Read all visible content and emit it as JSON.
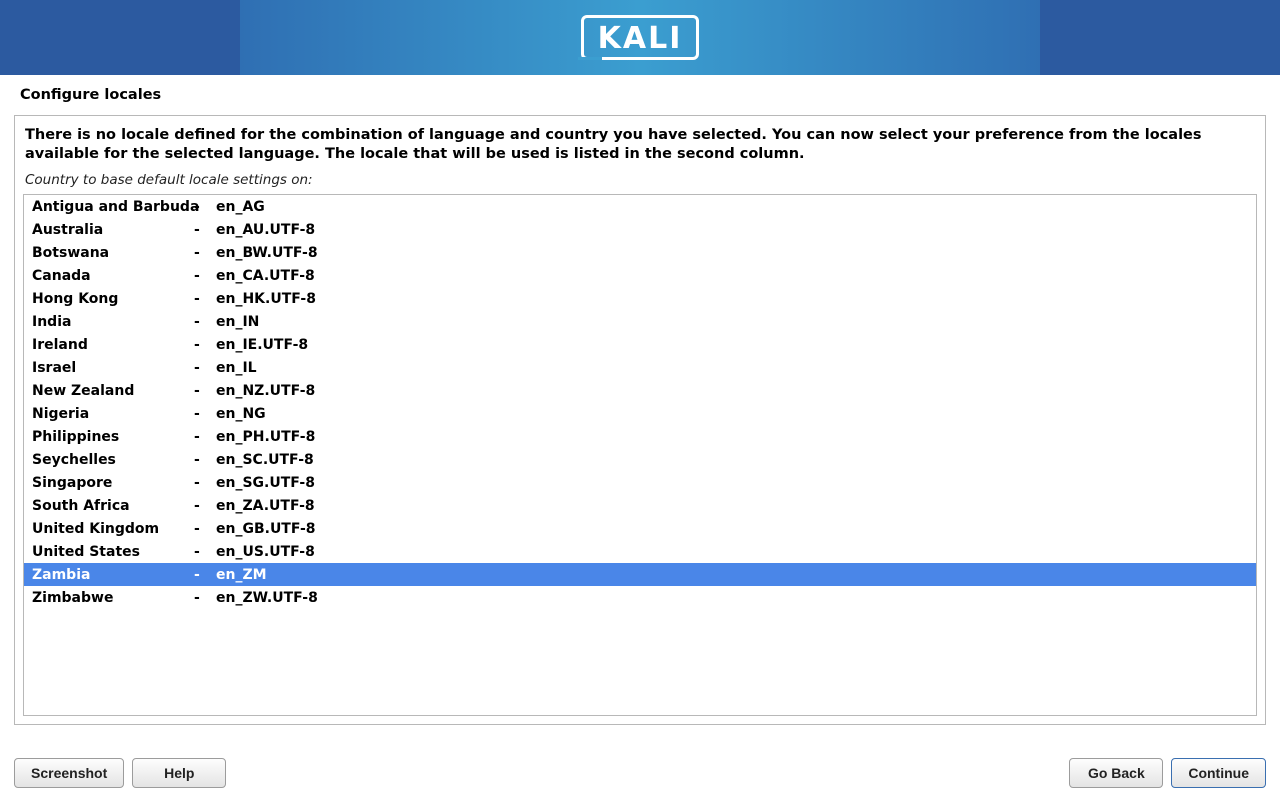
{
  "header": {
    "logo_text": "KALI"
  },
  "page_title": "Configure locales",
  "description": "There is no locale defined for the combination of language and country you have selected. You can now select your preference from the locales available for the selected language. The locale that will be used is listed in the second column.",
  "sub_caption": "Country to base default locale settings on:",
  "selected_index": 16,
  "locales": [
    {
      "country": "Antigua and Barbuda",
      "locale": "en_AG"
    },
    {
      "country": "Australia",
      "locale": "en_AU.UTF-8"
    },
    {
      "country": "Botswana",
      "locale": "en_BW.UTF-8"
    },
    {
      "country": "Canada",
      "locale": "en_CA.UTF-8"
    },
    {
      "country": "Hong Kong",
      "locale": "en_HK.UTF-8"
    },
    {
      "country": "India",
      "locale": "en_IN"
    },
    {
      "country": "Ireland",
      "locale": "en_IE.UTF-8"
    },
    {
      "country": "Israel",
      "locale": "en_IL"
    },
    {
      "country": "New Zealand",
      "locale": "en_NZ.UTF-8"
    },
    {
      "country": "Nigeria",
      "locale": "en_NG"
    },
    {
      "country": "Philippines",
      "locale": "en_PH.UTF-8"
    },
    {
      "country": "Seychelles",
      "locale": "en_SC.UTF-8"
    },
    {
      "country": "Singapore",
      "locale": "en_SG.UTF-8"
    },
    {
      "country": "South Africa",
      "locale": "en_ZA.UTF-8"
    },
    {
      "country": "United Kingdom",
      "locale": "en_GB.UTF-8"
    },
    {
      "country": "United States",
      "locale": "en_US.UTF-8"
    },
    {
      "country": "Zambia",
      "locale": "en_ZM"
    },
    {
      "country": "Zimbabwe",
      "locale": "en_ZW.UTF-8"
    }
  ],
  "footer": {
    "screenshot": "Screenshot",
    "help": "Help",
    "go_back": "Go Back",
    "continue": "Continue"
  },
  "dash": "-"
}
